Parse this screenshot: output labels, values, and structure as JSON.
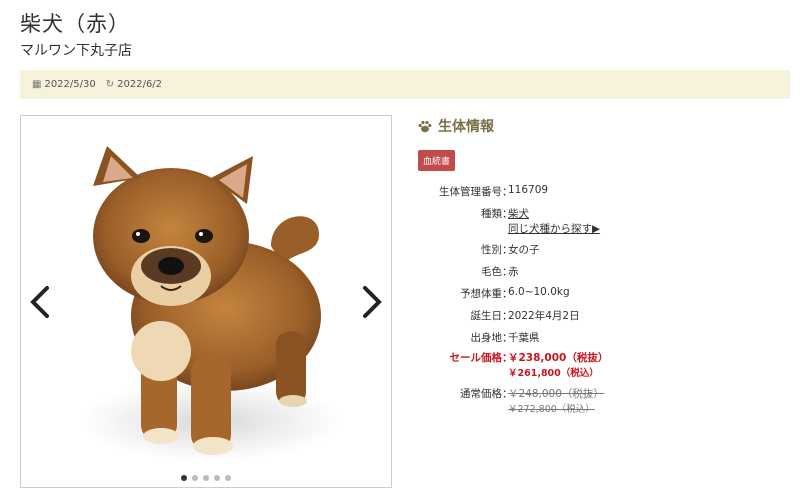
{
  "header": {
    "title": "柴犬（赤）",
    "shop": "マルワン下丸子店"
  },
  "dates": {
    "posted": "2022/5/30",
    "updated": "2022/6/2"
  },
  "gallery": {
    "slides": 5,
    "active_index": 0
  },
  "info": {
    "title": "生体情報",
    "badge": "血統書",
    "fields": [
      {
        "label": "生体管理番号",
        "value": "116709"
      },
      {
        "label": "種類",
        "value": "柴犬",
        "link": "同じ犬種から探す▶"
      },
      {
        "label": "性別",
        "value": "女の子"
      },
      {
        "label": "毛色",
        "value": "赤"
      },
      {
        "label": "予想体重",
        "value": "6.0~10.0kg"
      },
      {
        "label": "誕生日",
        "value": "2022年4月2日"
      },
      {
        "label": "出身地",
        "value": "千葉県"
      }
    ],
    "sale": {
      "label": "セール価格",
      "excl": "￥238,000（税抜）",
      "incl": "￥261,800（税込）"
    },
    "regular": {
      "label": "通常価格",
      "excl": "￥248,000（税抜）",
      "incl": "￥272,800（税込）"
    }
  },
  "colors": {
    "accent": "#7a7047",
    "sale": "#c8161d",
    "badge": "#c24a4a",
    "datebar": "#f6f2dc"
  }
}
